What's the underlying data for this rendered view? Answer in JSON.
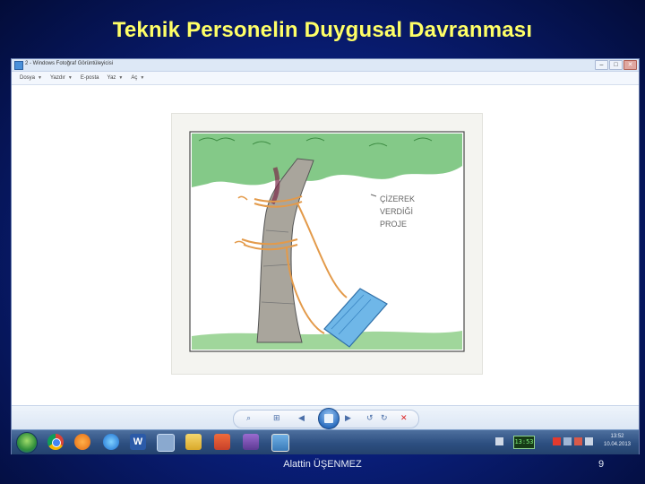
{
  "slide": {
    "title": "Teknik Personelin Duygusal Davranması",
    "author": "Alattin ÜŞENMEZ",
    "page_number": "9"
  },
  "window": {
    "title": "2 - Windows Fotoğraf Görüntüleyicisi",
    "buttons": {
      "minimize": "–",
      "maximize": "□",
      "close": "✕"
    }
  },
  "menu": {
    "items": [
      "Dosya",
      "Yazdır",
      "E-posta",
      "Yaz",
      "Aç"
    ]
  },
  "image": {
    "caption_lines": [
      "ÇİZEREK",
      "VERDİĞİ",
      "PROJE"
    ]
  },
  "taskbar": {
    "clock_pill": "13:53",
    "clock_time": "13:52",
    "clock_date": "10.04.2013"
  },
  "colors": {
    "slide_background": "#0a2080",
    "title": "#ffff66",
    "window_chrome": "#dde8f6",
    "taskbar": "#2d4f80"
  }
}
